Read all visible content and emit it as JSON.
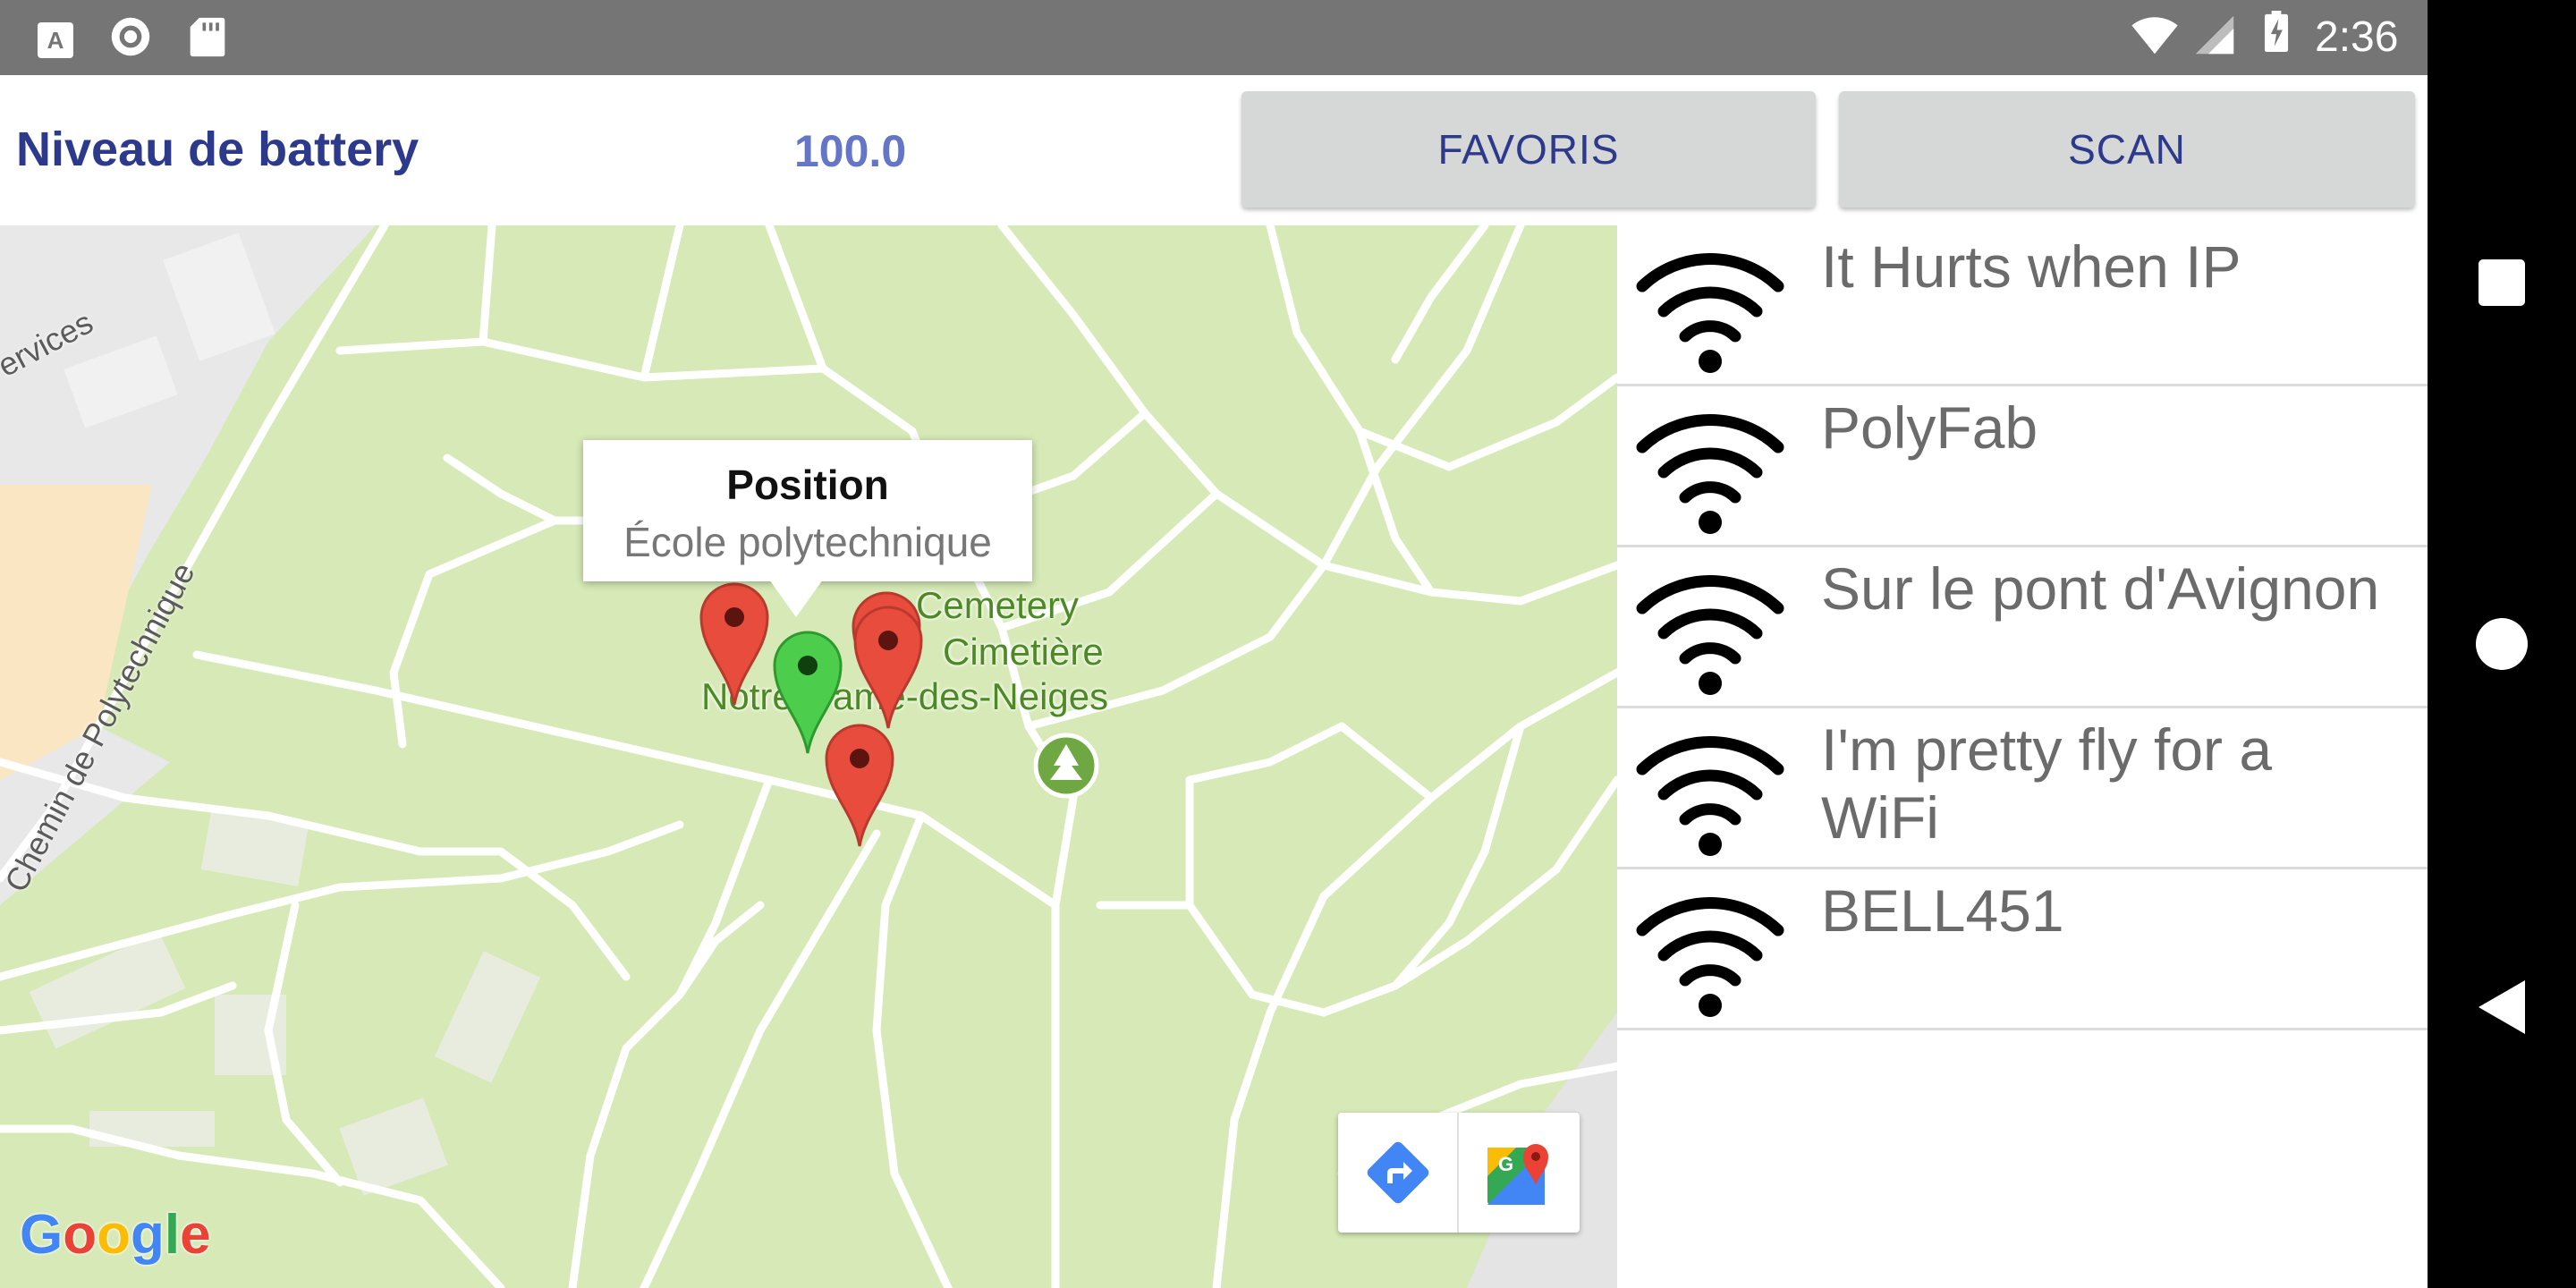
{
  "status_bar": {
    "time": "2:36",
    "left_icons": [
      "keyboard-a-icon",
      "circle-record-icon",
      "sd-card-icon"
    ],
    "right_icons": [
      "wifi-signal-icon",
      "cell-signal-icon",
      "battery-charging-icon"
    ]
  },
  "header": {
    "battery_label": "Niveau de battery",
    "battery_value": "100.0",
    "favoris_label": "FAVORIS",
    "scan_label": "SCAN"
  },
  "map": {
    "info_title": "Position",
    "info_subtitle": "École polytechnique",
    "cemetery_line1": "Cemetery",
    "cemetery_line2": "Cimetière",
    "cemetery_line3": "Notre-Dame-des-Neiges",
    "street_services": "ervices",
    "street_polytechnique": "Chemin de Polytechnique",
    "google_logo_letters": [
      "G",
      "o",
      "o",
      "g",
      "l",
      "e"
    ],
    "google_logo_colors": [
      "#4285F4",
      "#EA4335",
      "#FBBC05",
      "#4285F4",
      "#34A853",
      "#EA4335"
    ],
    "marker_colors": {
      "red": "#e74c3c",
      "green": "#4ccd4c"
    },
    "toolbar_icons": [
      "directions-icon",
      "google-maps-icon"
    ]
  },
  "wifi_networks": [
    {
      "name": "It Hurts when IP"
    },
    {
      "name": "PolyFab"
    },
    {
      "name": "Sur le pont d'Avignon"
    },
    {
      "name": "I'm pretty fly for a WiFi"
    },
    {
      "name": "BELL451"
    }
  ],
  "nav_bar": {
    "icons": [
      "recents-square-icon",
      "home-circle-icon",
      "back-triangle-icon"
    ]
  }
}
